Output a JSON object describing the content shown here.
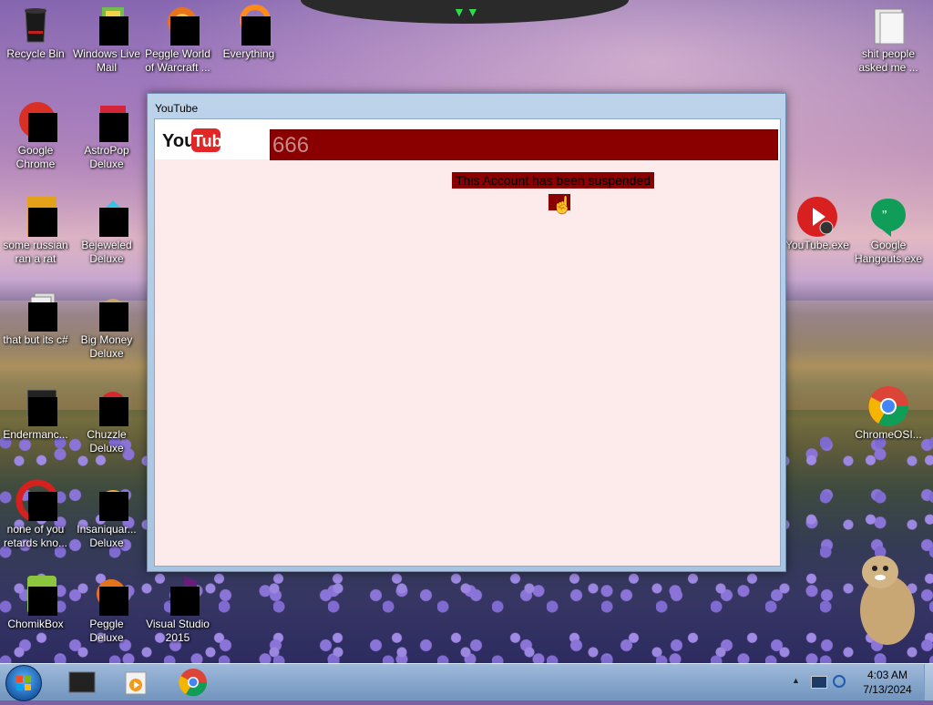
{
  "desktop": {
    "icons_left": [
      {
        "label": "Recycle Bin",
        "icon": "recycle-bin-icon"
      },
      {
        "label": "Windows Live Mail",
        "icon": "windows-live-mail-icon"
      },
      {
        "label": "Peggle World of Warcraft ...",
        "icon": "peggle-wow-icon"
      },
      {
        "label": "Everything",
        "icon": "everything-search-icon"
      },
      {
        "label": "Google Chrome",
        "icon": "google-chrome-icon"
      },
      {
        "label": "AstroPop Deluxe",
        "icon": "astropop-icon"
      },
      {
        "label": "some russian ran a rat",
        "icon": "adobe-icon"
      },
      {
        "label": "Bejeweled Deluxe",
        "icon": "bejeweled-icon"
      },
      {
        "label": "that but its c#",
        "icon": "stacked-windows-icon"
      },
      {
        "label": "Big Money Deluxe",
        "icon": "big-money-icon"
      },
      {
        "label": "Endermanc...",
        "icon": "terminal-icon"
      },
      {
        "label": "Chuzzle Deluxe",
        "icon": "chuzzle-icon"
      },
      {
        "label": "none of you retards kno...",
        "icon": "opera-icon"
      },
      {
        "label": "Insaniquar... Deluxe",
        "icon": "insaniquarium-icon"
      },
      {
        "label": "ChomikBox",
        "icon": "chomikbox-icon"
      },
      {
        "label": "Peggle Deluxe",
        "icon": "peggle-icon"
      },
      {
        "label": "Visual Studio 2015",
        "icon": "visual-studio-icon"
      }
    ],
    "icons_right": [
      {
        "label": "shit people asked me ...",
        "icon": "folder-icon"
      },
      {
        "label": "YouTube.exe",
        "icon": "youtube-exe-icon"
      },
      {
        "label": "Google Hangouts.exe",
        "icon": "hangouts-icon"
      },
      {
        "label": "ChromeOSI...",
        "icon": "chrome-os-icon"
      }
    ]
  },
  "window": {
    "title": "YouTube",
    "logo_text_you": "You",
    "logo_text_tube": "Tube",
    "input_value": "666",
    "message": "This Account has been suspended",
    "colors": {
      "accent": "#8a0000",
      "body_bg": "#fdeaea"
    }
  },
  "taskbar": {
    "time": "4:03 AM",
    "date": "7/13/2024",
    "tray_arrow": "▲"
  }
}
